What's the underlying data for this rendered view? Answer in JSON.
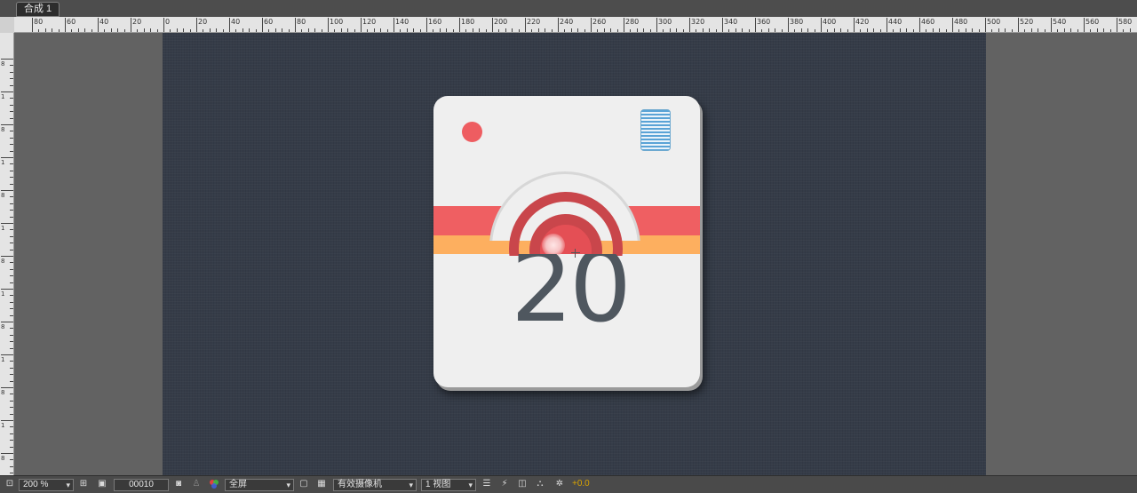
{
  "composition_tab": {
    "label": "合成 1"
  },
  "rulers": {
    "horizontal_labels": [
      "80",
      "60",
      "40",
      "20",
      "0",
      "20",
      "40",
      "60",
      "80",
      "100",
      "120",
      "140",
      "160",
      "180",
      "200",
      "220",
      "240",
      "260",
      "280",
      "300",
      "320",
      "340",
      "360",
      "380",
      "400",
      "420",
      "440",
      "460",
      "480",
      "500",
      "520",
      "540",
      "560",
      "580"
    ],
    "vertical_labels": [
      "8",
      "1",
      "8",
      "1",
      "8",
      "1",
      "8",
      "1",
      "8",
      "1",
      "8",
      "1",
      "8"
    ]
  },
  "icon": {
    "number": "20",
    "colors": {
      "card": "#efefef",
      "red_stripe": "#ef5f62",
      "orange_stripe": "#fdaf5f",
      "dot": "#ee5d61",
      "viewfinder": "#5aa3d6",
      "number": "#4f575f",
      "background": "#353c48"
    }
  },
  "toolbar": {
    "zoom": "200 %",
    "timecode": "00010",
    "resolution": "全屏",
    "camera": "有效摄像机",
    "views": "1 视图",
    "exposure": "+0.0",
    "icons": {
      "region_of_interest": "region-icon",
      "snapshot": "camera-icon",
      "show_snapshot": "person-icon",
      "channel": "rgb-channel-icon",
      "fast_preview": "fast-preview-icon",
      "transparency_grid": "checkerboard-icon",
      "timeline": "timeline-icon",
      "comp_flowchart": "flowchart-icon",
      "reset_exposure": "exposure-icon"
    }
  }
}
